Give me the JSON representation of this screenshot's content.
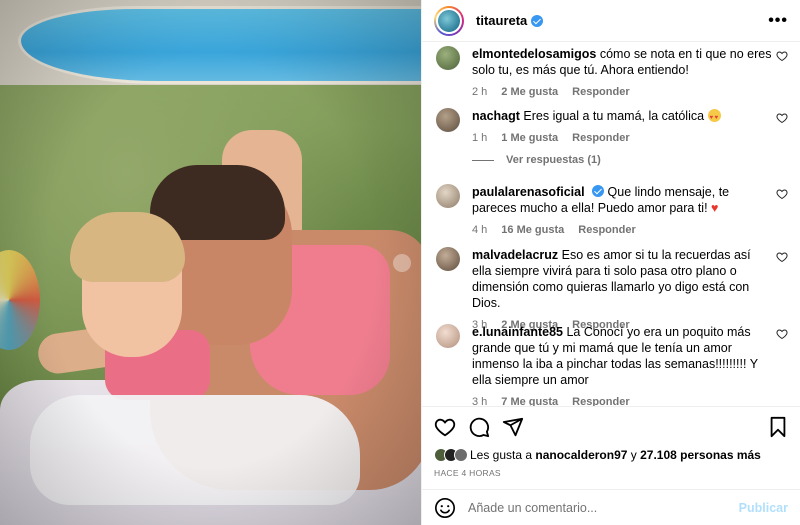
{
  "post": {
    "username": "titaureta",
    "verified": true
  },
  "comments": [
    {
      "user": "elmontedelosamigos",
      "text": "cómo se nota en ti que no eres solo tu, es más que tú. Ahora entiendo!",
      "time": "2 h",
      "likes": "2 Me gusta",
      "reply": "Responder",
      "avatar_color": "#6a7d4f"
    },
    {
      "user": "nachagt",
      "text": "Eres igual a tu mamá, la católica",
      "emoji": "heart-eyes",
      "time": "1 h",
      "likes": "1 Me gusta",
      "reply": "Responder",
      "avatar_color": "#7a6a5a"
    },
    {
      "user": "paulalarenasoficial",
      "verified": true,
      "text": "Que lindo mensaje, te pareces mucho a ella! Puedo amor para ti!",
      "emoji": "red-heart",
      "time": "4 h",
      "likes": "16 Me gusta",
      "reply": "Responder",
      "avatar_color": "#c9b7a4"
    },
    {
      "user": "malvadelacruz",
      "text": "Eso es amor si tu la recuerdas así ella siempre vivirá para ti solo pasa otro plano o dimensión como quieras llamarlo yo digo está con Dios.",
      "time": "3 h",
      "likes": "2 Me gusta",
      "reply": "Responder",
      "avatar_color": "#8a7561"
    },
    {
      "user": "e.lunainfante85",
      "text": "La Conocí yo era un poquito más grande que tú y mi mamá que le tenía un amor inmenso la iba a pinchar todas las semanas!!!!!!!!! Y ella siempre un amor",
      "time": "3 h",
      "likes": "7 Me gusta",
      "reply": "Responder",
      "avatar_color": "#d9b9a8"
    }
  ],
  "view_replies": "Ver respuestas (1)",
  "likes": {
    "prefix": "Les gusta a",
    "user": "nanocalderon97",
    "middle": "y",
    "count": "27.108 personas más"
  },
  "time_ago": "HACE 4 HORAS",
  "add_comment": {
    "placeholder": "Añade un comentario...",
    "publish": "Publicar"
  },
  "icons": {
    "more": "more-icon",
    "heart": "heart-icon",
    "comment": "comment-icon",
    "share": "share-icon",
    "bookmark": "bookmark-icon",
    "emoji": "emoji-icon"
  },
  "colors": {
    "verified": "#3897f0",
    "secondary_text": "#737373",
    "publish_disabled": "#b2dffc"
  }
}
